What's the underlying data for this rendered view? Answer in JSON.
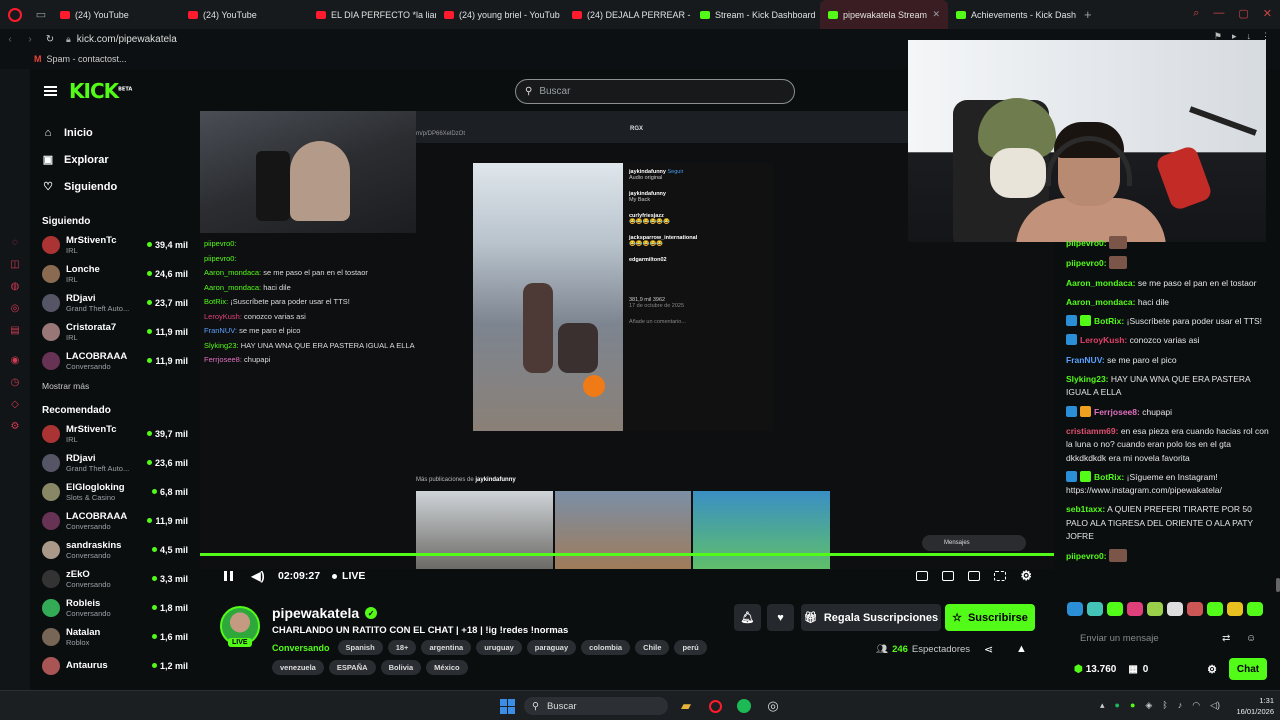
{
  "browser": {
    "tabs": [
      {
        "title": "(24) YouTube",
        "fav": "#ff1b2d"
      },
      {
        "title": "(24) YouTube",
        "fav": "#ff1b2d"
      },
      {
        "title": "EL DIA PERFECTO *la liam",
        "fav": "#ff1b2d"
      },
      {
        "title": "(24) young briel - YouTub",
        "fav": "#ff1b2d"
      },
      {
        "title": "(24) DEJALA PERREAR - Y",
        "fav": "#ff1b2d"
      },
      {
        "title": "Stream - Kick Dashboard",
        "fav": "#53fc18"
      },
      {
        "title": "pipewakatela Stream",
        "fav": "#53fc18",
        "active": true
      },
      {
        "title": "Achievements - Kick Dash",
        "fav": "#53fc18"
      }
    ],
    "url": "kick.com/pipewakatela",
    "bookmark": "Spam - contactost...",
    "accent": "#ff1b2d"
  },
  "kick": {
    "logo": "KICK",
    "logo_sup": "BETA",
    "nav": [
      {
        "label": "Inicio",
        "icon": "home-icon",
        "glyph": "⌂"
      },
      {
        "label": "Explorar",
        "icon": "browse-icon",
        "glyph": "▣"
      },
      {
        "label": "Siguiendo",
        "icon": "heart-icon",
        "glyph": "♡"
      }
    ],
    "following_title": "Siguiendo",
    "following": [
      {
        "name": "MrStivenTc",
        "category": "IRL",
        "viewers": "39,4 mil",
        "color": "#a33"
      },
      {
        "name": "Lonche",
        "category": "IRL",
        "viewers": "24,6 mil",
        "color": "#8a6b52"
      },
      {
        "name": "RDjavi",
        "category": "Grand Theft Auto...",
        "viewers": "23,7 mil",
        "color": "#556"
      },
      {
        "name": "Cristorata7",
        "category": "IRL",
        "viewers": "11,9 mil",
        "color": "#977"
      },
      {
        "name": "LACOBRAAA",
        "category": "Conversando",
        "viewers": "11,9 mil",
        "color": "#635"
      }
    ],
    "show_more": "Mostrar más",
    "recommended_title": "Recomendado",
    "recommended": [
      {
        "name": "MrStivenTc",
        "category": "IRL",
        "viewers": "39,7 mil",
        "color": "#a33"
      },
      {
        "name": "RDjavi",
        "category": "Grand Theft Auto...",
        "viewers": "23,6 mil",
        "color": "#556"
      },
      {
        "name": "ElGlogloking",
        "category": "Slots & Casino",
        "viewers": "6,8 mil",
        "color": "#886"
      },
      {
        "name": "LACOBRAAA",
        "category": "Conversando",
        "viewers": "11,9 mil",
        "color": "#635"
      },
      {
        "name": "sandraskins",
        "category": "Conversando",
        "viewers": "4,5 mil",
        "color": "#a98"
      },
      {
        "name": "zEkO",
        "category": "Conversando",
        "viewers": "3,3 mil",
        "color": "#333"
      },
      {
        "name": "Robleis",
        "category": "Conversando",
        "viewers": "1,8 mil",
        "color": "#3a5"
      },
      {
        "name": "Natalan",
        "category": "Roblox",
        "viewers": "1,6 mil",
        "color": "#765"
      },
      {
        "name": "Antaurus",
        "category": "",
        "viewers": "1,2 mil",
        "color": "#a55"
      }
    ],
    "search_placeholder": "Buscar",
    "accent": "#53fc18"
  },
  "video_content": {
    "chat_lines": [
      {
        "user": "piipevro0:",
        "text": "",
        "color": "#53fc18"
      },
      {
        "user": "piipevro0:",
        "text": "",
        "color": "#53fc18"
      },
      {
        "user": "Aaron_mondaca:",
        "text": "se me paso el pan en el tostaor",
        "color": "#53fc18"
      },
      {
        "user": "Aaron_mondaca:",
        "text": "haci dile",
        "color": "#53fc18"
      },
      {
        "user": "BotRix:",
        "text": "¡Suscríbete para poder usar el TTS!",
        "color": "#53fc18"
      },
      {
        "user": "LeroyKush:",
        "text": "conozco varias asi",
        "color": "#e0407a"
      },
      {
        "user": "FranNUV:",
        "text": "se me paro el pico",
        "color": "#5aa0ff"
      },
      {
        "user": "Slyking23:",
        "text": "HAY UNA WNA QUE ERA PASTERA IGUAL A ELLA",
        "color": "#53fc18"
      },
      {
        "user": "Ferrjosee8:",
        "text": "chupapi",
        "color": "#e070c0"
      }
    ],
    "insta_user": "jaykindafunny",
    "insta_follow": "Seguir",
    "insta_audio": "Audio original",
    "insta_comments": [
      {
        "user": "jaykindafunny",
        "text": "My Back"
      },
      {
        "user": "curlyfriesjazz",
        "text": "😂😂😂😂😂😂"
      },
      {
        "user": "jacksparrow_international",
        "text": "😂😂😂😂😂"
      },
      {
        "user": "edgarmilton02",
        "text": ""
      }
    ],
    "insta_stats": "381,9 mil   3962",
    "insta_date": "17 de octubre de 2025",
    "insta_add_comment": "Añade un comentario...",
    "more_posts_prefix": "Más publicaciones de",
    "more_posts_user": "jaykindafunny",
    "rgx": "RGX",
    "messages_label": "Mensajes"
  },
  "player": {
    "time": "02:09:27",
    "live": "LIVE",
    "progress": 1.0
  },
  "channel": {
    "name": "pipewakatela",
    "live_badge": "LIVE",
    "title": "CHARLANDO UN RATITO CON EL CHAT | +18 | !ig !redes !normas",
    "category": "Conversando",
    "tags_row1": [
      "Spanish",
      "18+",
      "argentina",
      "uruguay",
      "paraguay",
      "colombia",
      "Chile",
      "perú"
    ],
    "tags_row2": [
      "venezuela",
      "ESPAÑA",
      "Bolivia",
      "México"
    ],
    "gift_label": "Regala Suscripciones",
    "subscribe_label": "Suscribirse",
    "viewers_count": "246",
    "viewers_label": "Espectadores"
  },
  "chat": {
    "messages": [
      {
        "user": "piipevro0:",
        "text": "",
        "color": "#53fc18",
        "emote": true
      },
      {
        "user": "piipevro0:",
        "text": "",
        "color": "#53fc18",
        "emote": true
      },
      {
        "user": "Aaron_mondaca:",
        "text": "se me paso el pan en el tostaor",
        "color": "#53fc18"
      },
      {
        "user": "Aaron_mondaca:",
        "text": "haci dile",
        "color": "#53fc18"
      },
      {
        "user": "BotRix:",
        "text": "¡Suscríbete para poder usar el TTS!",
        "color": "#53fc18",
        "badges": [
          "#2a8fd6",
          "#53fc18"
        ]
      },
      {
        "user": "LeroyKush:",
        "text": "conozco varias asi",
        "color": "#e0406a",
        "badges": [
          "#2a8fd6"
        ]
      },
      {
        "user": "FranNUV:",
        "text": "se me paro el pico",
        "color": "#5aa0ff"
      },
      {
        "user": "Slyking23:",
        "text": "HAY UNA WNA QUE ERA PASTERA IGUAL A ELLA",
        "color": "#53fc18"
      },
      {
        "user": "Ferrjosee8:",
        "text": "chupapi",
        "color": "#e070c0",
        "badges": [
          "#2a8fd6",
          "#f0a020"
        ]
      },
      {
        "user": "cristiamm69:",
        "text": "en esa pieza era cuando hacias rol con la luna o no? cuando eran polo los en el gta dkkdkdkdk era mi novela favorita",
        "color": "#e05070"
      },
      {
        "user": "BotRix:",
        "text": "¡Sígueme en Instagram! https://www.instagram.com/pipewakatela/",
        "color": "#53fc18",
        "badges": [
          "#2a8fd6",
          "#53fc18"
        ]
      },
      {
        "user": "seb1taxx:",
        "text": "A QUIEN PREFERI TIRARTE POR 50 PALO ALA TIGRESA DEL ORIENTE O ALA PATY JOFRE",
        "color": "#53fc18"
      },
      {
        "user": "piipevro0:",
        "text": "",
        "color": "#53fc18",
        "emote": true
      }
    ],
    "input_placeholder": "Enviar un mensaje",
    "points": "13.760",
    "gifts": "0",
    "chat_button": "Chat"
  },
  "taskbar": {
    "search": "Buscar",
    "time": "1:31",
    "date": "16/01/2026"
  }
}
